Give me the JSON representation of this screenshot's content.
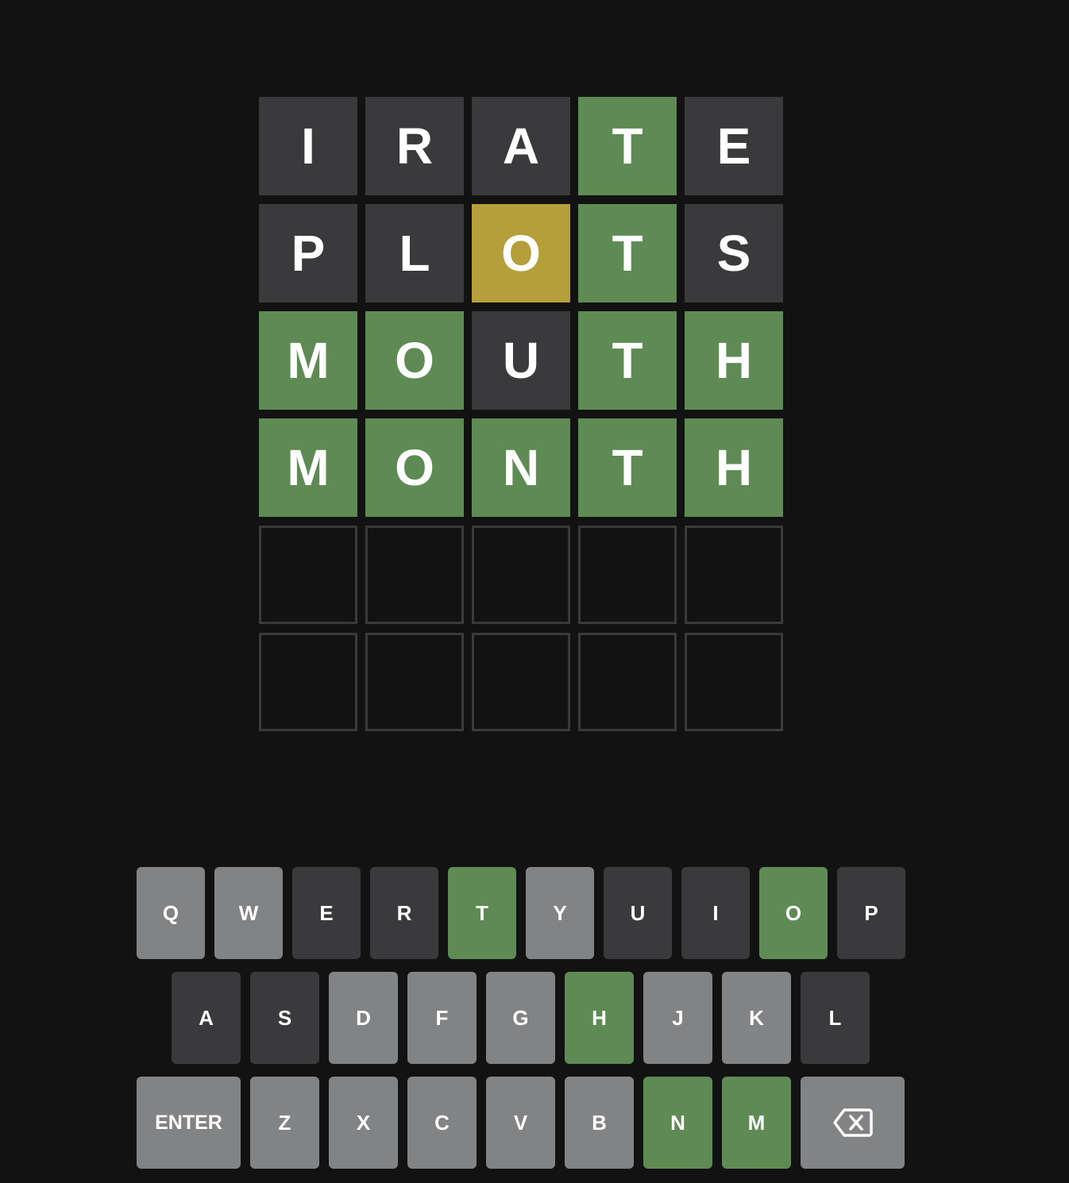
{
  "colors": {
    "background": "#121213",
    "absent": "#3a3a3c",
    "present": "#b59f3b",
    "correct": "#5e8b53",
    "unused": "#818384",
    "empty_border": "#3a3a3c",
    "text": "#ffffff"
  },
  "board": {
    "rows": [
      [
        {
          "letter": "I",
          "state": "absent"
        },
        {
          "letter": "R",
          "state": "absent"
        },
        {
          "letter": "A",
          "state": "absent"
        },
        {
          "letter": "T",
          "state": "correct"
        },
        {
          "letter": "E",
          "state": "absent"
        }
      ],
      [
        {
          "letter": "P",
          "state": "absent"
        },
        {
          "letter": "L",
          "state": "absent"
        },
        {
          "letter": "O",
          "state": "present"
        },
        {
          "letter": "T",
          "state": "correct"
        },
        {
          "letter": "S",
          "state": "absent"
        }
      ],
      [
        {
          "letter": "M",
          "state": "correct"
        },
        {
          "letter": "O",
          "state": "correct"
        },
        {
          "letter": "U",
          "state": "absent"
        },
        {
          "letter": "T",
          "state": "correct"
        },
        {
          "letter": "H",
          "state": "correct"
        }
      ],
      [
        {
          "letter": "M",
          "state": "correct"
        },
        {
          "letter": "O",
          "state": "correct"
        },
        {
          "letter": "N",
          "state": "correct"
        },
        {
          "letter": "T",
          "state": "correct"
        },
        {
          "letter": "H",
          "state": "correct"
        }
      ],
      [
        {
          "letter": "",
          "state": "empty"
        },
        {
          "letter": "",
          "state": "empty"
        },
        {
          "letter": "",
          "state": "empty"
        },
        {
          "letter": "",
          "state": "empty"
        },
        {
          "letter": "",
          "state": "empty"
        }
      ],
      [
        {
          "letter": "",
          "state": "empty"
        },
        {
          "letter": "",
          "state": "empty"
        },
        {
          "letter": "",
          "state": "empty"
        },
        {
          "letter": "",
          "state": "empty"
        },
        {
          "letter": "",
          "state": "empty"
        }
      ]
    ]
  },
  "keyboard": {
    "rows": [
      [
        {
          "label": "Q",
          "state": "unused"
        },
        {
          "label": "W",
          "state": "unused"
        },
        {
          "label": "E",
          "state": "absent"
        },
        {
          "label": "R",
          "state": "absent"
        },
        {
          "label": "T",
          "state": "correct"
        },
        {
          "label": "Y",
          "state": "unused"
        },
        {
          "label": "U",
          "state": "absent"
        },
        {
          "label": "I",
          "state": "absent"
        },
        {
          "label": "O",
          "state": "correct"
        },
        {
          "label": "P",
          "state": "absent"
        }
      ],
      [
        {
          "label": "A",
          "state": "absent"
        },
        {
          "label": "S",
          "state": "absent"
        },
        {
          "label": "D",
          "state": "unused"
        },
        {
          "label": "F",
          "state": "unused"
        },
        {
          "label": "G",
          "state": "unused"
        },
        {
          "label": "H",
          "state": "correct"
        },
        {
          "label": "J",
          "state": "unused"
        },
        {
          "label": "K",
          "state": "unused"
        },
        {
          "label": "L",
          "state": "absent"
        }
      ],
      [
        {
          "label": "ENTER",
          "state": "unused",
          "wide": true
        },
        {
          "label": "Z",
          "state": "unused"
        },
        {
          "label": "X",
          "state": "unused"
        },
        {
          "label": "C",
          "state": "unused"
        },
        {
          "label": "V",
          "state": "unused"
        },
        {
          "label": "B",
          "state": "unused"
        },
        {
          "label": "N",
          "state": "correct"
        },
        {
          "label": "M",
          "state": "correct"
        },
        {
          "label": "",
          "state": "unused",
          "wide": true,
          "icon": "backspace-icon"
        }
      ]
    ]
  }
}
